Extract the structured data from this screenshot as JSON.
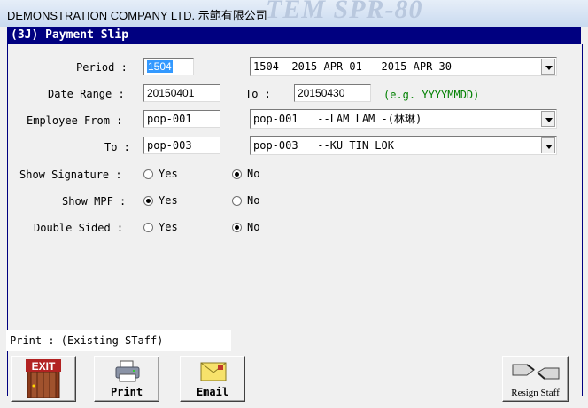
{
  "window": {
    "title": "DEMONSTRATION COMPANY LTD. 示範有限公司",
    "watermark": "TEM SPR-80"
  },
  "form": {
    "header": "(3J) Payment Slip",
    "period": {
      "label": "Period :",
      "value": "1504",
      "combo": "1504  2015-APR-01   2015-APR-30"
    },
    "date_range": {
      "label": "Date Range :",
      "from": "20150401",
      "to_label": "To :",
      "to": "20150430",
      "hint": "(e.g. YYYYMMDD)"
    },
    "employee_from": {
      "label": "Employee From :",
      "value": "pop-001",
      "combo": "pop-001   --LAM LAM -(林琳)"
    },
    "employee_to": {
      "label": "To :",
      "value": "pop-003",
      "combo": "pop-003   --KU TIN LOK"
    },
    "show_signature": {
      "label": "Show Signature :",
      "yes": "Yes",
      "no": "No",
      "selected": "No"
    },
    "show_mpf": {
      "label": "Show MPF :",
      "yes": "Yes",
      "no": "No",
      "selected": "Yes"
    },
    "double_sided": {
      "label": "Double Sided :",
      "yes": "Yes",
      "no": "No",
      "selected": "No"
    }
  },
  "status": "Print : (Existing STaff)",
  "buttons": {
    "exit": "EXIT",
    "print": "Print",
    "email": "Email",
    "resign": "Resign Staff"
  }
}
